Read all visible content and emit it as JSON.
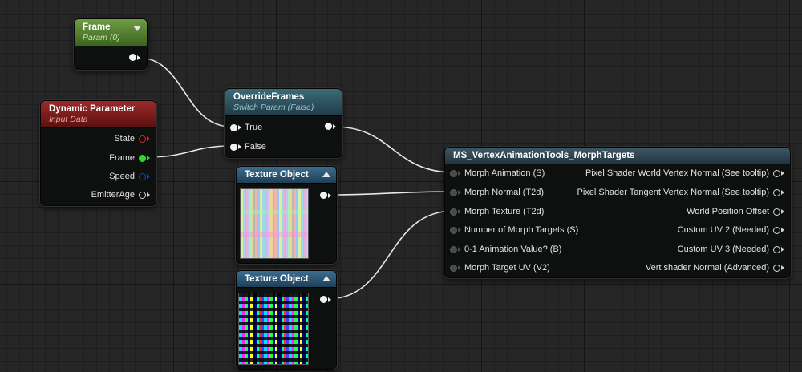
{
  "nodes": {
    "frame": {
      "title": "Frame",
      "subtitle": "Param (0)"
    },
    "dynamic_parameter": {
      "title": "Dynamic Parameter",
      "subtitle": "Input Data",
      "outputs": [
        "State",
        "Frame",
        "Speed",
        "EmitterAge"
      ]
    },
    "override_frames": {
      "title": "OverrideFrames",
      "subtitle": "Switch Param (False)",
      "inputs": [
        "True",
        "False"
      ]
    },
    "texture_object_1": {
      "title": "Texture Object"
    },
    "texture_object_2": {
      "title": "Texture Object"
    },
    "morph_targets": {
      "title": "MS_VertexAnimationTools_MorphTargets",
      "inputs": [
        "Morph Animation (S)",
        "Morph Normal (T2d)",
        "Morph Texture (T2d)",
        "Number of Morph Targets (S)",
        "0-1 Animation Value? (B)",
        "Morph Target UV (V2)"
      ],
      "outputs": [
        "Pixel Shader World Vertex Normal (See tooltip)",
        "Pixel Shader Tangent Vertex Normal (See tooltip)",
        "World Position Offset",
        "Custom UV 2 (Needed)",
        "Custom UV 3 (Needed)",
        "Vert shader Normal (Advanced)"
      ]
    }
  },
  "colors": {
    "param_header": "#6e9e43",
    "dynamic_header": "#9c2a2a",
    "switch_header": "#3b6a78",
    "texture_header": "#3c6e8f",
    "function_header": "#3e5866",
    "pin_state": "#e0232a",
    "pin_frame": "#2fd82f",
    "pin_speed": "#1f3fd6",
    "wire": "#e8e8e8"
  },
  "icons": [
    "collapse-arrow-down-icon",
    "collapse-arrow-up-icon"
  ]
}
